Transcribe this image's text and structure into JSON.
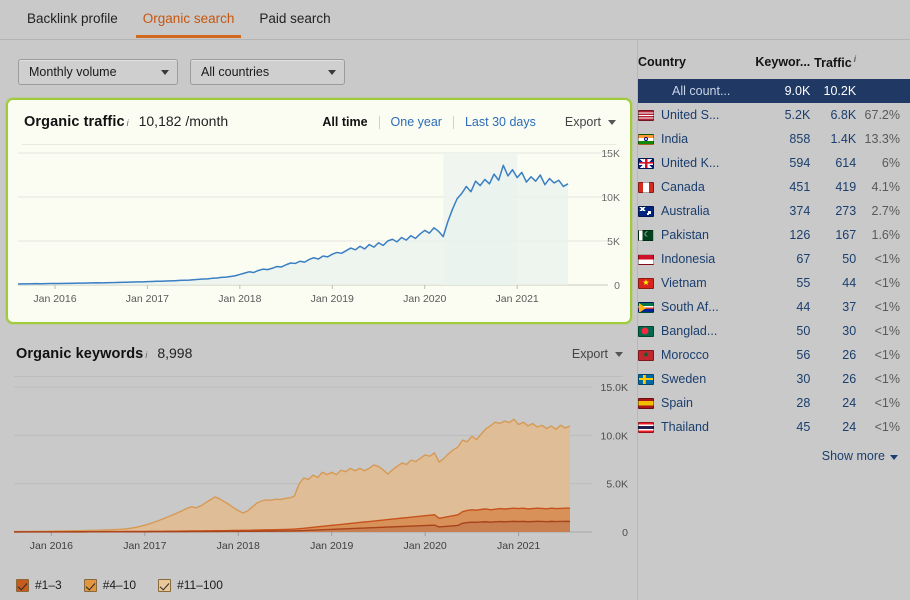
{
  "tabs": [
    {
      "label": "Backlink profile",
      "active": false
    },
    {
      "label": "Organic search",
      "active": true
    },
    {
      "label": "Paid search",
      "active": false
    }
  ],
  "filters": {
    "volume": {
      "value": "Monthly volume"
    },
    "country": {
      "value": "All countries"
    }
  },
  "traffic_panel": {
    "title": "Organic traffic",
    "info_mark": "i",
    "value": "10,182 /month",
    "ranges": [
      {
        "label": "All time",
        "active": true
      },
      {
        "label": "One year",
        "active": false
      },
      {
        "label": "Last 30 days",
        "active": false
      }
    ],
    "export_label": "Export"
  },
  "keywords_panel": {
    "title": "Organic keywords",
    "info_mark": "i",
    "value": "8,998",
    "export_label": "Export",
    "legend": [
      {
        "label": "#1–3",
        "color": "#c85a1e",
        "checked": true
      },
      {
        "label": "#4–10",
        "color": "#e2963f",
        "checked": true
      },
      {
        "label": "#11–100",
        "color": "#e8c79a",
        "checked": true
      }
    ]
  },
  "country_table": {
    "headers": [
      "Country",
      "Keywor...",
      "Traffic"
    ],
    "traffic_info_mark": "i",
    "rows": [
      {
        "country": "All count...",
        "keywords": "9.0K",
        "traffic": "10.2K",
        "share": "",
        "selected": true,
        "flag": null
      },
      {
        "country": "United S...",
        "keywords": "5.2K",
        "traffic": "6.8K",
        "share": "67.2%",
        "selected": false,
        "flag": "us"
      },
      {
        "country": "India",
        "keywords": "858",
        "traffic": "1.4K",
        "share": "13.3%",
        "selected": false,
        "flag": "in"
      },
      {
        "country": "United K...",
        "keywords": "594",
        "traffic": "614",
        "share": "6%",
        "selected": false,
        "flag": "gb"
      },
      {
        "country": "Canada",
        "keywords": "451",
        "traffic": "419",
        "share": "4.1%",
        "selected": false,
        "flag": "ca"
      },
      {
        "country": "Australia",
        "keywords": "374",
        "traffic": "273",
        "share": "2.7%",
        "selected": false,
        "flag": "au"
      },
      {
        "country": "Pakistan",
        "keywords": "126",
        "traffic": "167",
        "share": "1.6%",
        "selected": false,
        "flag": "pk"
      },
      {
        "country": "Indonesia",
        "keywords": "67",
        "traffic": "50",
        "share": "<1%",
        "selected": false,
        "flag": "id"
      },
      {
        "country": "Vietnam",
        "keywords": "55",
        "traffic": "44",
        "share": "<1%",
        "selected": false,
        "flag": "vn"
      },
      {
        "country": "South Af...",
        "keywords": "44",
        "traffic": "37",
        "share": "<1%",
        "selected": false,
        "flag": "za"
      },
      {
        "country": "Banglad...",
        "keywords": "50",
        "traffic": "30",
        "share": "<1%",
        "selected": false,
        "flag": "bd"
      },
      {
        "country": "Morocco",
        "keywords": "56",
        "traffic": "26",
        "share": "<1%",
        "selected": false,
        "flag": "ma"
      },
      {
        "country": "Sweden",
        "keywords": "30",
        "traffic": "26",
        "share": "<1%",
        "selected": false,
        "flag": "se"
      },
      {
        "country": "Spain",
        "keywords": "28",
        "traffic": "24",
        "share": "<1%",
        "selected": false,
        "flag": "es"
      },
      {
        "country": "Thailand",
        "keywords": "45",
        "traffic": "24",
        "share": "<1%",
        "selected": false,
        "flag": "th"
      }
    ],
    "show_more": "Show more"
  },
  "chart_data": [
    {
      "id": "organic_traffic",
      "type": "line",
      "title": "Organic traffic",
      "xlabel": "",
      "ylabel": "",
      "ylim": [
        0,
        15000
      ],
      "yticks": [
        0,
        5000,
        10000,
        15000
      ],
      "ytick_labels": [
        "0",
        "5K",
        "10K",
        "15K"
      ],
      "xtick_labels": [
        "Jan 2016",
        "Jan 2017",
        "Jan 2018",
        "Jan 2019",
        "Jan 2020",
        "Jan 2021"
      ],
      "grid": true,
      "legend": "none",
      "line_color": "#3a7ec4",
      "fill_color": "#e8f2ec",
      "series": [
        {
          "name": "Organic traffic",
          "values": [
            120,
            130,
            128,
            140,
            150,
            145,
            160,
            170,
            165,
            175,
            185,
            190,
            200,
            210,
            215,
            230,
            240,
            250,
            245,
            260,
            275,
            280,
            300,
            310,
            320,
            340,
            360,
            355,
            380,
            400,
            420,
            430,
            450,
            470,
            490,
            520,
            540,
            560,
            600,
            640,
            680,
            700,
            760,
            800,
            860,
            900,
            960,
            1050,
            1200,
            1350,
            1500,
            1420,
            1650,
            1800,
            1750,
            1900,
            2100,
            2050,
            2300,
            2500,
            2450,
            2700,
            2600,
            2900,
            3100,
            2950,
            3300,
            3200,
            3500,
            3700,
            3600,
            3900,
            4200,
            4000,
            4400,
            4100,
            4600,
            4300,
            4800,
            4500,
            5000,
            5200,
            4900,
            5400,
            5100,
            5600,
            5300,
            5800,
            6200,
            5900,
            6500,
            6100,
            5500,
            7200,
            8600,
            9800,
            10400,
            11200,
            10600,
            11800,
            11300,
            12000,
            11500,
            12600,
            11900,
            13600,
            12400,
            13100,
            12200,
            12800,
            11700,
            12300,
            11800,
            12500,
            11400,
            12100,
            11600,
            11900,
            11200,
            11500
          ]
        }
      ]
    },
    {
      "id": "organic_keywords",
      "type": "area",
      "title": "Organic keywords",
      "xlabel": "",
      "ylabel": "",
      "ylim": [
        0,
        15000
      ],
      "yticks": [
        0,
        5000,
        10000,
        15000
      ],
      "ytick_labels": [
        "0",
        "5.0K",
        "10.0K",
        "15.0K"
      ],
      "xtick_labels": [
        "Jan 2016",
        "Jan 2017",
        "Jan 2018",
        "Jan 2019",
        "Jan 2020",
        "Jan 2021"
      ],
      "grid": true,
      "stacked": true,
      "series": [
        {
          "name": "#1–3",
          "color": "#a8431c",
          "fill": "#c97a46",
          "values": [
            5,
            5,
            6,
            6,
            7,
            7,
            8,
            8,
            9,
            9,
            10,
            10,
            11,
            12,
            12,
            13,
            14,
            15,
            15,
            16,
            17,
            18,
            19,
            20,
            21,
            22,
            23,
            24,
            25,
            26,
            28,
            29,
            30,
            32,
            33,
            35,
            36,
            38,
            40,
            42,
            44,
            46,
            48,
            50,
            52,
            55,
            58,
            60,
            63,
            66,
            70,
            74,
            78,
            82,
            86,
            90,
            95,
            100,
            105,
            110,
            120,
            135,
            150,
            170,
            190,
            210,
            230,
            250,
            270,
            290,
            310,
            330,
            350,
            370,
            390,
            410,
            430,
            450,
            470,
            490,
            510,
            530,
            550,
            570,
            590,
            610,
            630,
            650,
            670,
            690,
            710,
            520,
            560,
            600,
            640,
            680,
            900,
            980,
            1020,
            1000,
            1040,
            1060,
            1020,
            1050,
            1080,
            1060,
            1080,
            1100,
            1080,
            1100,
            1060,
            1080,
            1100,
            1090,
            1070,
            1100,
            1080,
            1090,
            1100,
            1100
          ]
        },
        {
          "name": "#4–10",
          "color": "#c8521d",
          "fill": "#d98c4e",
          "values": [
            8,
            8,
            9,
            9,
            10,
            11,
            11,
            12,
            13,
            13,
            14,
            15,
            16,
            17,
            18,
            19,
            20,
            21,
            22,
            23,
            25,
            26,
            28,
            29,
            31,
            32,
            34,
            36,
            38,
            40,
            42,
            44,
            46,
            49,
            51,
            54,
            56,
            59,
            62,
            65,
            68,
            71,
            75,
            78,
            82,
            86,
            90,
            94,
            99,
            104,
            109,
            115,
            121,
            127,
            134,
            140,
            148,
            155,
            163,
            172,
            185,
            210,
            235,
            265,
            295,
            325,
            355,
            385,
            415,
            445,
            475,
            505,
            535,
            565,
            595,
            625,
            655,
            685,
            715,
            745,
            775,
            805,
            835,
            865,
            895,
            925,
            955,
            985,
            1015,
            1045,
            1075,
            900,
            950,
            1000,
            1050,
            1100,
            1200,
            1250,
            1280,
            1260,
            1300,
            1320,
            1280,
            1310,
            1340,
            1320,
            1340,
            1360,
            1340,
            1360,
            1320,
            1340,
            1360,
            1350,
            1330,
            1360,
            1340,
            1350,
            1360,
            1360
          ]
        },
        {
          "name": "#11–100",
          "color": "#d79a55",
          "fill": "#e0bc93",
          "values": [
            30,
            35,
            38,
            42,
            46,
            50,
            55,
            60,
            66,
            72,
            78,
            85,
            92,
            100,
            108,
            118,
            128,
            140,
            152,
            166,
            180,
            196,
            214,
            232,
            280,
            340,
            420,
            520,
            640,
            780,
            940,
            1120,
            1300,
            1500,
            1700,
            1900,
            2100,
            2350,
            2500,
            2400,
            2600,
            2900,
            3200,
            3500,
            3300,
            3000,
            2700,
            2350,
            2050,
            1800,
            2000,
            2400,
            2800,
            3000,
            3100,
            3050,
            3150,
            3100,
            3200,
            3250,
            3400,
            4600,
            5200,
            5000,
            5400,
            5100,
            5600,
            5300,
            5500,
            5200,
            5600,
            5400,
            5700,
            5400,
            5600,
            5300,
            5500,
            5800,
            5600,
            5200,
            4700,
            5100,
            5400,
            5700,
            5500,
            5900,
            5700,
            6000,
            6300,
            6100,
            6400,
            5800,
            6100,
            6500,
            6800,
            7000,
            7400,
            7100,
            7600,
            7300,
            7800,
            8300,
            8700,
            9000,
            8800,
            9100,
            8900,
            9200,
            8700,
            8900,
            8600,
            8800,
            8400,
            8600,
            8300,
            8500,
            8200,
            8600,
            8300,
            8500
          ]
        }
      ]
    }
  ]
}
